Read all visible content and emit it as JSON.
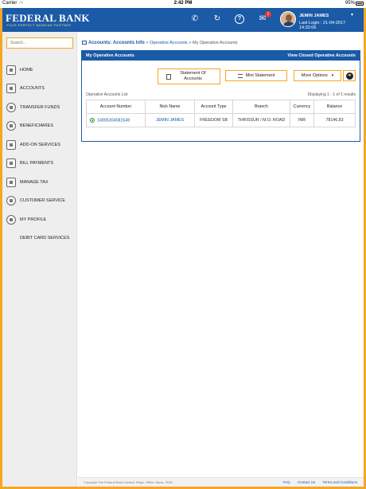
{
  "status_bar": {
    "carrier": "Carrier",
    "wifi_icon": "wifi-icon",
    "time": "2:42 PM",
    "battery": "95%"
  },
  "header": {
    "brand": "FEDERAL BANK",
    "tagline": "YOUR PERFECT BANKING PARTNER",
    "icons": [
      "phone-icon",
      "refresh-icon",
      "help-icon",
      "mail-icon"
    ],
    "notification_count": "1",
    "user_name": "JEMIN JAMES",
    "last_login": "Last Login : 21-04-2017 14:32:06",
    "colors": {
      "primary": "#1a5aa6",
      "accent": "#f5a623"
    }
  },
  "sidebar": {
    "search_placeholder": "Search...",
    "items": [
      {
        "label": "HOME",
        "icon": "home-icon"
      },
      {
        "label": "ACCOUNTS",
        "icon": "accounts-icon"
      },
      {
        "label": "TRANSFER FUNDS",
        "icon": "transfer-icon"
      },
      {
        "label": "BENEFICIARIES",
        "icon": "beneficiaries-icon"
      },
      {
        "label": "ADD-ON SERVICES",
        "icon": "addon-icon"
      },
      {
        "label": "BILL PAYMENTS",
        "icon": "bill-icon"
      },
      {
        "label": "MANAGE TAX",
        "icon": "tax-icon"
      },
      {
        "label": "CUSTOMER SERVICE",
        "icon": "customer-service-icon"
      },
      {
        "label": "MY PROFILE",
        "icon": "profile-icon"
      },
      {
        "label": "DEBIT CARD SERVICES",
        "icon": ""
      }
    ]
  },
  "breadcrumb": {
    "section": "Accounts: Accounts Info",
    "sep1": ">",
    "level2": "Operative Accounts",
    "sep2": ">",
    "current": "My Operative Accounts"
  },
  "panel": {
    "title": "My Operative Accounts",
    "link": "View Closed Operative Accounts",
    "buttons": {
      "statement": "Statement Of Accounts",
      "mini": "Mini Statement",
      "more": "More Options",
      "more_caret": "▾",
      "go_icon": "➜"
    },
    "list_caption": "Operative Accounts List",
    "displaying": "Displaying 1 - 1 of 1 results",
    "columns": [
      "Account Number",
      "Nick Name",
      "Account Type",
      "Branch",
      "Currency",
      "Balance"
    ],
    "rows": [
      {
        "account_number": "14905304581549",
        "nick_name": "JEMIN JAMES",
        "account_type": "FREEDOM SB",
        "branch": "THRISSUR / M.O. ROAD",
        "currency": "INR",
        "balance": "78146.83"
      }
    ]
  },
  "footer": {
    "copyright": "Copyright The Federal Bank Limited. Regd. Office: Aluva, 2016.",
    "links": [
      "FAQ",
      "Contact Us",
      "Terms and Conditions"
    ]
  }
}
